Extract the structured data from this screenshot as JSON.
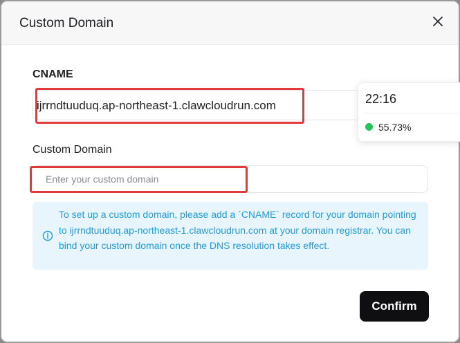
{
  "dialog": {
    "title": "Custom Domain",
    "close_icon": "close-icon"
  },
  "cname": {
    "label": "CNAME",
    "value": "ijrrndtuuduq.ap-northeast-1.clawcloudrun.com"
  },
  "custom_domain": {
    "label": "Custom Domain",
    "value": "",
    "placeholder": "Enter your custom domain"
  },
  "info": {
    "icon": "info-icon",
    "text": "To set up a custom domain, please add a `CNAME` record for your domain pointing to ijrrndtuuduq.ap-northeast-1.clawcloudrun.com at your domain registrar. You can bind your custom domain once the DNS resolution takes effect."
  },
  "confirm": {
    "label": "Confirm"
  },
  "status_popover": {
    "time": "22:16",
    "percent": "55.73%",
    "dot_color": "#22c55e"
  },
  "colors": {
    "highlight": "#e5383b",
    "info_text": "#219bd9",
    "info_bg": "#e9f5fc",
    "button_bg": "#0f0f12"
  }
}
